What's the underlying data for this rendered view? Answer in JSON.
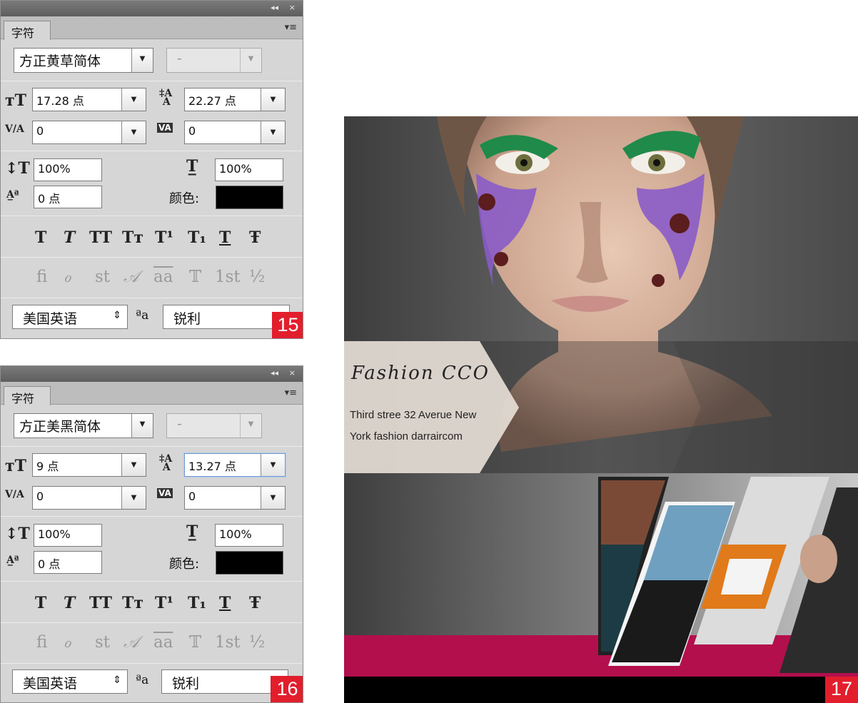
{
  "panel_top": {
    "titlebar": {
      "collapse": "◂◂",
      "close": "×"
    },
    "tab": "字符",
    "font_family": "方正黄草简体",
    "font_style": "-",
    "font_size": "17.28 点",
    "leading": "22.27 点",
    "kerning": "0",
    "tracking": "0",
    "vertical_scale": "100%",
    "horizontal_scale": "100%",
    "baseline_shift": "0 点",
    "color_label": "颜色:",
    "color": "#000000",
    "style_buttons": [
      "T",
      "T",
      "TT",
      "Tт",
      "T¹",
      "T₁",
      "T",
      "Ŧ"
    ],
    "opentype_buttons": [
      "fi",
      "ℴ",
      "st",
      "𝒜",
      "aa",
      "𝕋",
      "1st",
      "½"
    ],
    "language": "美国英语",
    "aa_icon": "ªa",
    "antialias": "锐利",
    "badge": "15"
  },
  "panel_bottom": {
    "titlebar": {
      "collapse": "◂◂",
      "close": "×"
    },
    "tab": "字符",
    "font_family": "方正美黑简体",
    "font_style": "-",
    "font_size": "9 点",
    "leading": "13.27 点",
    "kerning": "0",
    "tracking": "0",
    "vertical_scale": "100%",
    "horizontal_scale": "100%",
    "baseline_shift": "0 点",
    "color_label": "颜色:",
    "color": "#000000",
    "style_buttons": [
      "T",
      "T",
      "TT",
      "Tт",
      "T¹",
      "T₁",
      "T",
      "Ŧ"
    ],
    "opentype_buttons": [
      "fi",
      "ℴ",
      "st",
      "𝒜",
      "aa",
      "𝕋",
      "1st",
      "½"
    ],
    "language": "美国英语",
    "aa_icon": "ªa",
    "antialias": "锐利",
    "badge": "16"
  },
  "poster": {
    "title": "Fashion CCO",
    "line1": "Third stree 32 Averue New",
    "line2": "York fashion darraircom",
    "accent_color": "#b30f4d",
    "badge": "17"
  },
  "icons": {
    "font_size": "font-size-icon",
    "leading": "leading-icon",
    "kerning": "kerning-icon",
    "tracking": "tracking-icon",
    "vertical_scale": "vertical-scale-icon",
    "horizontal_scale": "horizontal-scale-icon",
    "baseline_shift": "baseline-shift-icon",
    "panel_menu": "panel-menu-icon"
  }
}
